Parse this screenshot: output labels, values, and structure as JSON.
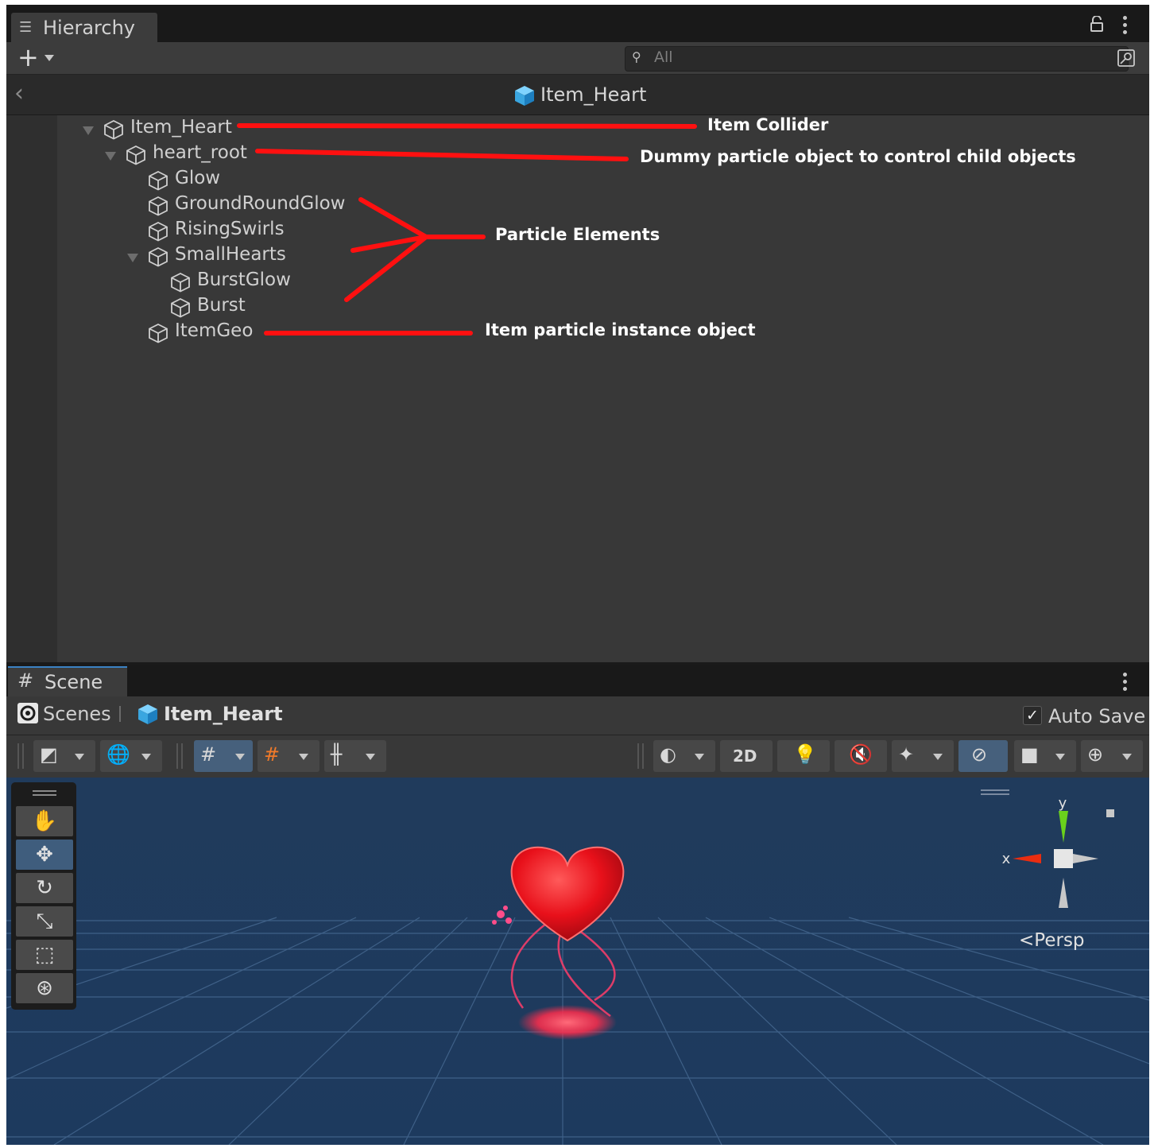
{
  "hierarchy": {
    "tab_label": "Hierarchy",
    "search_placeholder": "All",
    "breadcrumb_title": "Item_Heart",
    "tree": [
      {
        "label": "Item_Heart",
        "depth": 0,
        "expanded": true
      },
      {
        "label": "heart_root",
        "depth": 1,
        "expanded": true
      },
      {
        "label": "Glow",
        "depth": 2
      },
      {
        "label": "GroundRoundGlow",
        "depth": 2
      },
      {
        "label": "RisingSwirls",
        "depth": 2
      },
      {
        "label": "SmallHearts",
        "depth": 2,
        "expanded": true
      },
      {
        "label": "BurstGlow",
        "depth": 3
      },
      {
        "label": "Burst",
        "depth": 3
      },
      {
        "label": "ItemGeo",
        "depth": 2
      }
    ],
    "annotations": {
      "item_collider": "Item Collider",
      "dummy": "Dummy particle object to control child objects",
      "particle_elements": "Particle Elements",
      "instance": "Item particle instance object"
    },
    "annotation_color": "#ff1010"
  },
  "scene": {
    "tab_label": "Scene",
    "scenes_label": "Scenes",
    "item_label": "Item_Heart",
    "auto_save_label": "Auto Save",
    "auto_save_checked": true,
    "toolbar": {
      "mode_2d": "2D"
    },
    "tools": [
      "hand-icon",
      "move-icon",
      "rotate-icon",
      "scale-icon",
      "rect-icon",
      "transform-icon"
    ],
    "active_tool": "move-icon",
    "gizmo": {
      "x_label": "x",
      "y_label": "y",
      "projection": "Persp"
    },
    "colors": {
      "viewport_bg": "#1f3a5a",
      "heart": "#e8101a"
    }
  }
}
